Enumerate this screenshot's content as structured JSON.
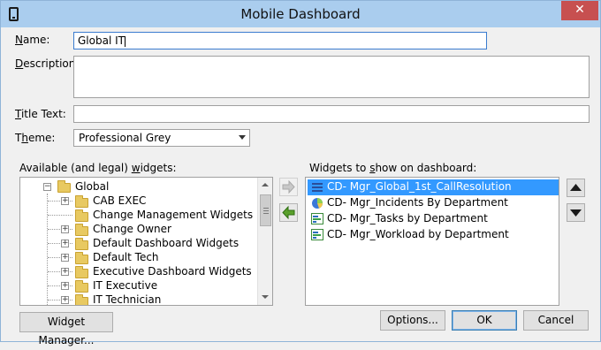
{
  "window": {
    "title": "Mobile Dashboard",
    "close_glyph": "✕"
  },
  "form": {
    "name_label_key": "N",
    "name_label_rest": "ame:",
    "name_value": "Global IT",
    "description_label_key": "D",
    "description_label_rest": "escription:",
    "description_value": "",
    "title_label_key": "T",
    "title_label_rest": "itle Text:",
    "title_value": "",
    "theme_label_pre": "T",
    "theme_label_key": "h",
    "theme_label_rest": "eme:",
    "theme_value": "Professional Grey"
  },
  "available": {
    "label_pre": "Available (and legal) ",
    "label_key": "w",
    "label_rest": "idgets:",
    "root": "Global",
    "items": [
      {
        "label": "CAB EXEC",
        "expandable": true
      },
      {
        "label": "Change Management Widgets",
        "expandable": false
      },
      {
        "label": "Change Owner",
        "expandable": true
      },
      {
        "label": "Default Dashboard Widgets",
        "expandable": true
      },
      {
        "label": "Default Tech",
        "expandable": true
      },
      {
        "label": "Executive Dashboard Widgets",
        "expandable": true
      },
      {
        "label": "IT Executive",
        "expandable": true
      },
      {
        "label": "IT Technician",
        "expandable": true
      }
    ]
  },
  "dashboard": {
    "label_pre": "Widgets to ",
    "label_key": "s",
    "label_rest": "how on dashboard:",
    "widgets": [
      {
        "label": "CD- Mgr_Global_1st_CallResolution",
        "icon": "list-chart-icon",
        "selected": true
      },
      {
        "label": "CD- Mgr_Incidents By Department",
        "icon": "pie-chart-icon",
        "selected": false
      },
      {
        "label": "CD- Mgr_Tasks by Department",
        "icon": "bar-chart-icon",
        "selected": false
      },
      {
        "label": "CD- Mgr_Workload by Department",
        "icon": "bar-chart-icon",
        "selected": false
      }
    ]
  },
  "buttons": {
    "widget_manager": "Widget Manager...",
    "options": "Options...",
    "ok": "OK",
    "cancel": "Cancel"
  },
  "colors": {
    "titlebar": "#aacdee",
    "close": "#c75050",
    "selection": "#3399ff",
    "add_arrow": "#5aa02c"
  }
}
